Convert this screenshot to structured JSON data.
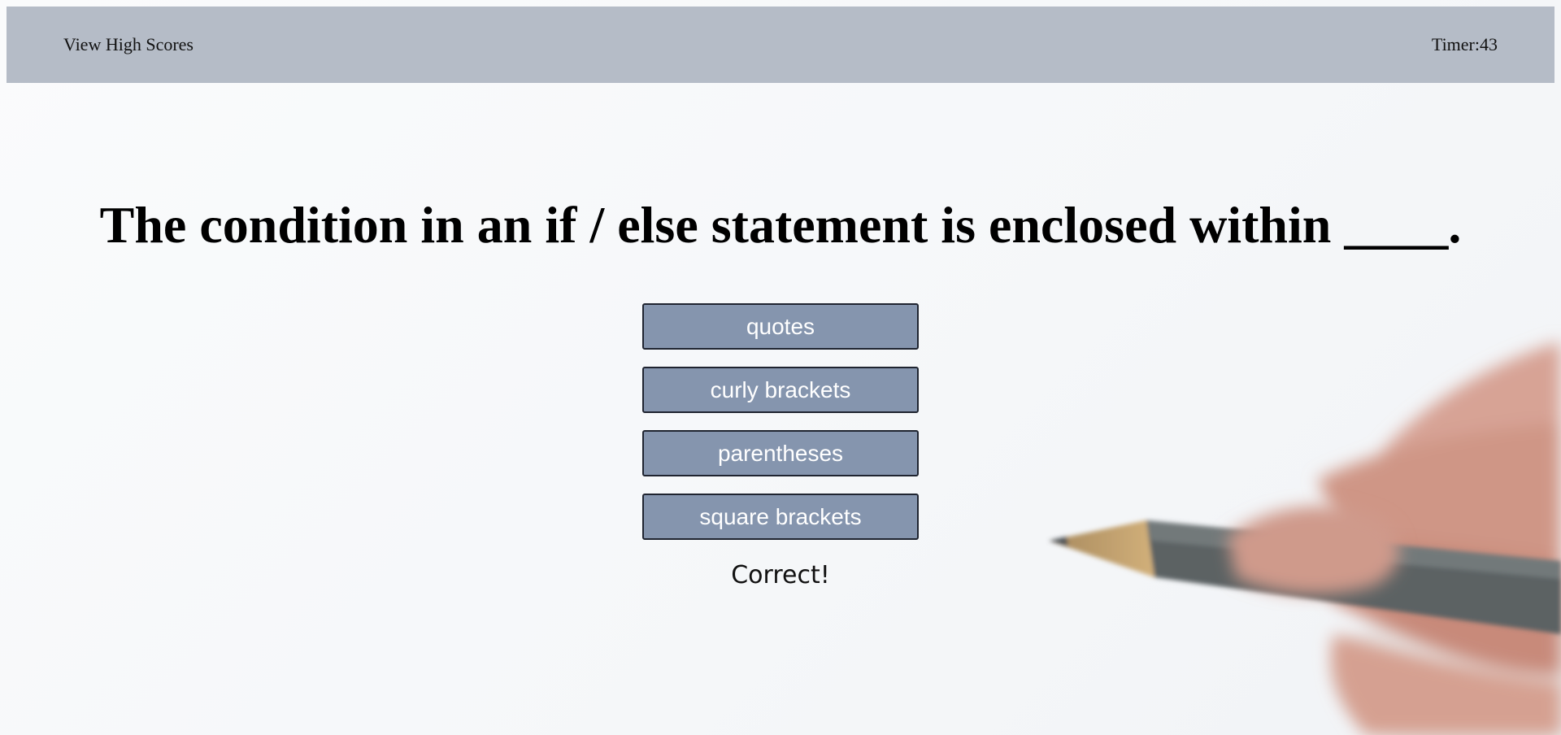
{
  "header": {
    "high_scores_label": "View High Scores",
    "timer_label": "Timer: ",
    "timer_value": "43"
  },
  "quiz": {
    "question": "The condition in an if / else statement is enclosed within ____.",
    "answers": [
      {
        "label": "quotes"
      },
      {
        "label": "curly brackets"
      },
      {
        "label": "parentheses"
      },
      {
        "label": "square brackets"
      }
    ],
    "feedback": "Correct!"
  },
  "colors": {
    "header_bg": "#b5bcc7",
    "button_bg": "#8595ae",
    "button_text": "#ffffff",
    "page_bg": "#f7f8fa"
  },
  "background_image": {
    "icon": "hand-writing-with-pencil"
  }
}
